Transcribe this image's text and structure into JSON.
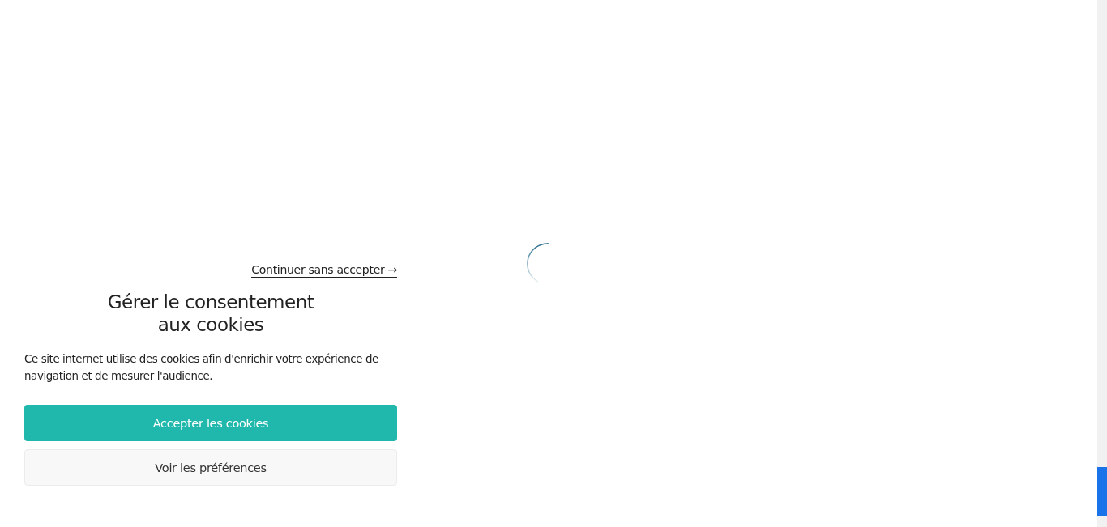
{
  "consent_panel": {
    "continue_link": "Continuer sans accepter →",
    "title_lines": [
      "Gérer le consentement",
      "aux cookies"
    ],
    "description": "Ce site internet utilise des cookies afin d'enrichir votre expérience de navigation et de mesurer l'audience.",
    "buttons": [
      {
        "label": "Accepter les cookies",
        "kind": "primary"
      },
      {
        "label": "Voir les préférences",
        "kind": "secondary"
      }
    ]
  }
}
